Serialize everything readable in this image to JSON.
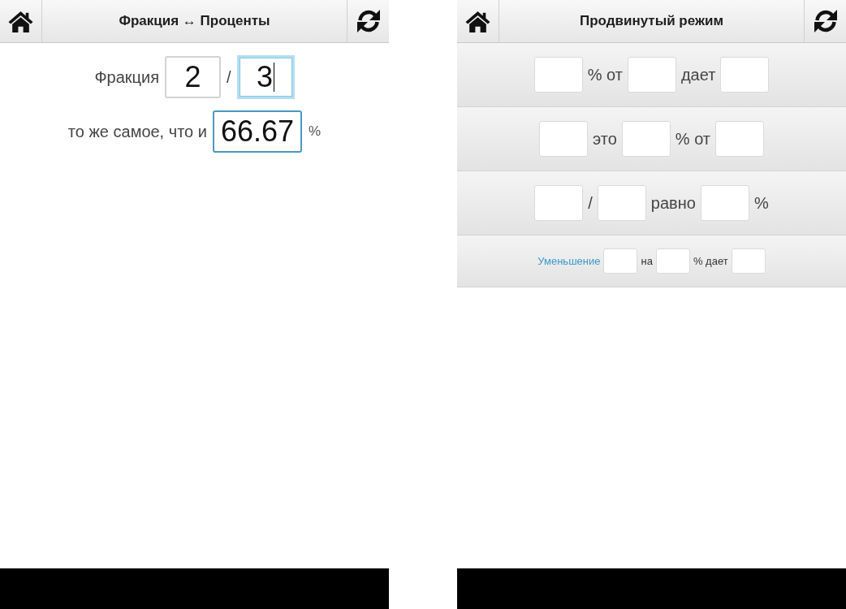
{
  "screens": [
    {
      "kind": "plain",
      "header": {
        "title": "Фракция ↔ Проценты"
      },
      "rows": [
        {
          "items": [
            {
              "kind": "text",
              "text": "Фракция"
            },
            {
              "kind": "field",
              "value": "2",
              "focused": false,
              "highlighted": false
            },
            {
              "kind": "text",
              "text": "/"
            },
            {
              "kind": "field",
              "value": "3",
              "focused": true,
              "highlighted": false
            }
          ]
        },
        {
          "items": [
            {
              "kind": "text",
              "text": "то же самое, что и"
            },
            {
              "kind": "field",
              "value": "66.67",
              "focused": false,
              "highlighted": true
            },
            {
              "kind": "unit",
              "text": "%"
            }
          ]
        }
      ]
    },
    {
      "kind": "panels",
      "header": {
        "title": "Продвинутый режим"
      },
      "rows": [
        {
          "compact": false,
          "items": [
            {
              "kind": "field",
              "focused": false,
              "highlighted": false
            },
            {
              "kind": "text",
              "text": "% от"
            },
            {
              "kind": "field",
              "focused": false,
              "highlighted": false
            },
            {
              "kind": "text",
              "text": "дает"
            },
            {
              "kind": "field",
              "focused": false,
              "highlighted": false
            }
          ]
        },
        {
          "compact": false,
          "items": [
            {
              "kind": "field",
              "focused": false,
              "highlighted": false
            },
            {
              "kind": "text",
              "text": "это"
            },
            {
              "kind": "field",
              "focused": false,
              "highlighted": false
            },
            {
              "kind": "text",
              "text": "% от"
            },
            {
              "kind": "field",
              "focused": false,
              "highlighted": false
            }
          ]
        },
        {
          "compact": false,
          "items": [
            {
              "kind": "field",
              "focused": false,
              "highlighted": false
            },
            {
              "kind": "text",
              "text": "/"
            },
            {
              "kind": "field",
              "focused": false,
              "highlighted": false
            },
            {
              "kind": "text",
              "text": "равно"
            },
            {
              "kind": "field",
              "focused": false,
              "highlighted": false
            },
            {
              "kind": "text",
              "text": "%"
            }
          ]
        },
        {
          "compact": true,
          "items": [
            {
              "kind": "link",
              "text": "Уменьшение"
            },
            {
              "kind": "field",
              "focused": false,
              "highlighted": false
            },
            {
              "kind": "text",
              "text": "на"
            },
            {
              "kind": "field",
              "focused": false,
              "highlighted": false
            },
            {
              "kind": "text",
              "text": "% дает"
            },
            {
              "kind": "field",
              "focused": false,
              "highlighted": false
            }
          ]
        }
      ]
    }
  ]
}
